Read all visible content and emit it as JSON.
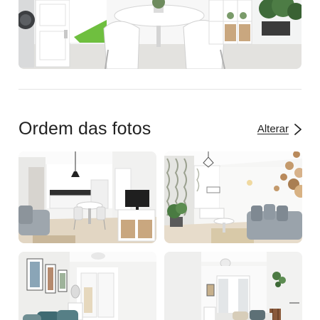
{
  "photo_order_section": {
    "title": "Ordem das fotos",
    "change_link": "Alterar"
  },
  "photos": [
    {
      "name": "hero-photo-dining"
    },
    {
      "name": "photo-living-kitchen"
    },
    {
      "name": "photo-living-sofa"
    },
    {
      "name": "photo-bedroom-1"
    },
    {
      "name": "photo-bedroom-2"
    }
  ]
}
